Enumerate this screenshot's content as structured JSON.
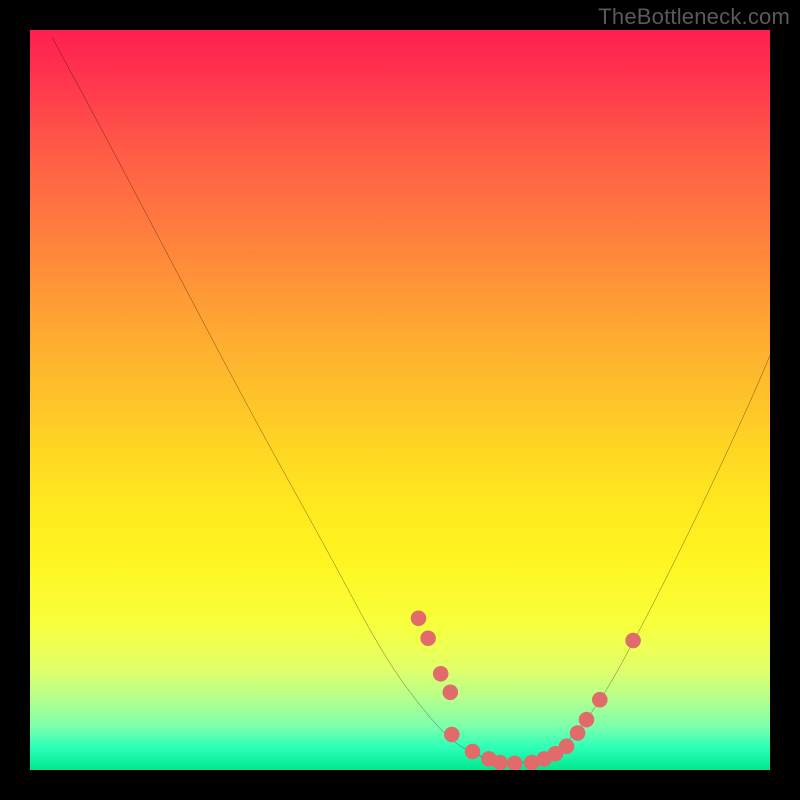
{
  "watermark": "TheBottleneck.com",
  "chart_data": {
    "type": "line",
    "title": "",
    "xlabel": "",
    "ylabel": "",
    "xlim": [
      0,
      100
    ],
    "ylim": [
      0,
      100
    ],
    "grid": false,
    "curve": [
      {
        "x": 3,
        "y": 99
      },
      {
        "x": 10,
        "y": 86
      },
      {
        "x": 20,
        "y": 67
      },
      {
        "x": 30,
        "y": 48
      },
      {
        "x": 40,
        "y": 30
      },
      {
        "x": 48,
        "y": 15
      },
      {
        "x": 54,
        "y": 7
      },
      {
        "x": 58,
        "y": 3
      },
      {
        "x": 63,
        "y": 1
      },
      {
        "x": 68,
        "y": 1
      },
      {
        "x": 72,
        "y": 3
      },
      {
        "x": 77,
        "y": 9
      },
      {
        "x": 83,
        "y": 20
      },
      {
        "x": 90,
        "y": 34
      },
      {
        "x": 97,
        "y": 49
      },
      {
        "x": 100,
        "y": 56
      }
    ],
    "points": [
      {
        "x": 52.5,
        "y": 20.5
      },
      {
        "x": 53.8,
        "y": 17.8
      },
      {
        "x": 55.5,
        "y": 13.0
      },
      {
        "x": 56.8,
        "y": 10.5
      },
      {
        "x": 57.0,
        "y": 4.8
      },
      {
        "x": 59.8,
        "y": 2.5
      },
      {
        "x": 62.0,
        "y": 1.5
      },
      {
        "x": 63.5,
        "y": 1.0
      },
      {
        "x": 65.5,
        "y": 0.9
      },
      {
        "x": 67.8,
        "y": 1.0
      },
      {
        "x": 69.5,
        "y": 1.5
      },
      {
        "x": 71.0,
        "y": 2.2
      },
      {
        "x": 72.5,
        "y": 3.2
      },
      {
        "x": 74.0,
        "y": 5.0
      },
      {
        "x": 75.2,
        "y": 6.8
      },
      {
        "x": 77.0,
        "y": 9.5
      },
      {
        "x": 81.5,
        "y": 17.5
      }
    ],
    "point_color": "#e16a6a",
    "curve_color": "#000000"
  }
}
